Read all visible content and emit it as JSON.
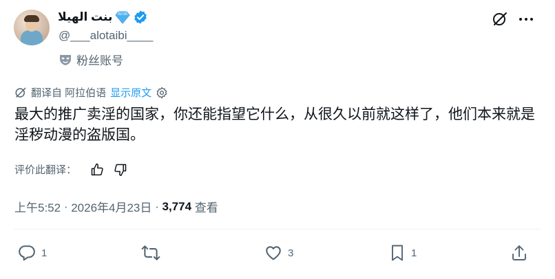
{
  "author": {
    "display_name": "بنت الهيلا",
    "handle": "@___alotaibi____",
    "account_label": "粉丝账号"
  },
  "translation": {
    "translated_from": "翻译自 阿拉伯语",
    "show_original": "显示原文"
  },
  "tweet": {
    "text": "最大的推广卖淫的国家，你还能指望它什么，从很久以前就这样了，他们本来就是淫秽动漫的盗版国。"
  },
  "rating": {
    "label": "评价此翻译："
  },
  "meta": {
    "time": "上午5:52",
    "separator1": " · ",
    "date": "2026年4月23日",
    "separator2": " · ",
    "views_count": "3,774",
    "views_label": " 查看"
  },
  "actions": {
    "replies": "1",
    "retweets": "",
    "likes": "3",
    "bookmarks": "1"
  },
  "colors": {
    "accent": "#1d9bf0",
    "secondary_text": "#536471",
    "primary_text": "#0f1419",
    "verified": "#1d9bf0"
  }
}
